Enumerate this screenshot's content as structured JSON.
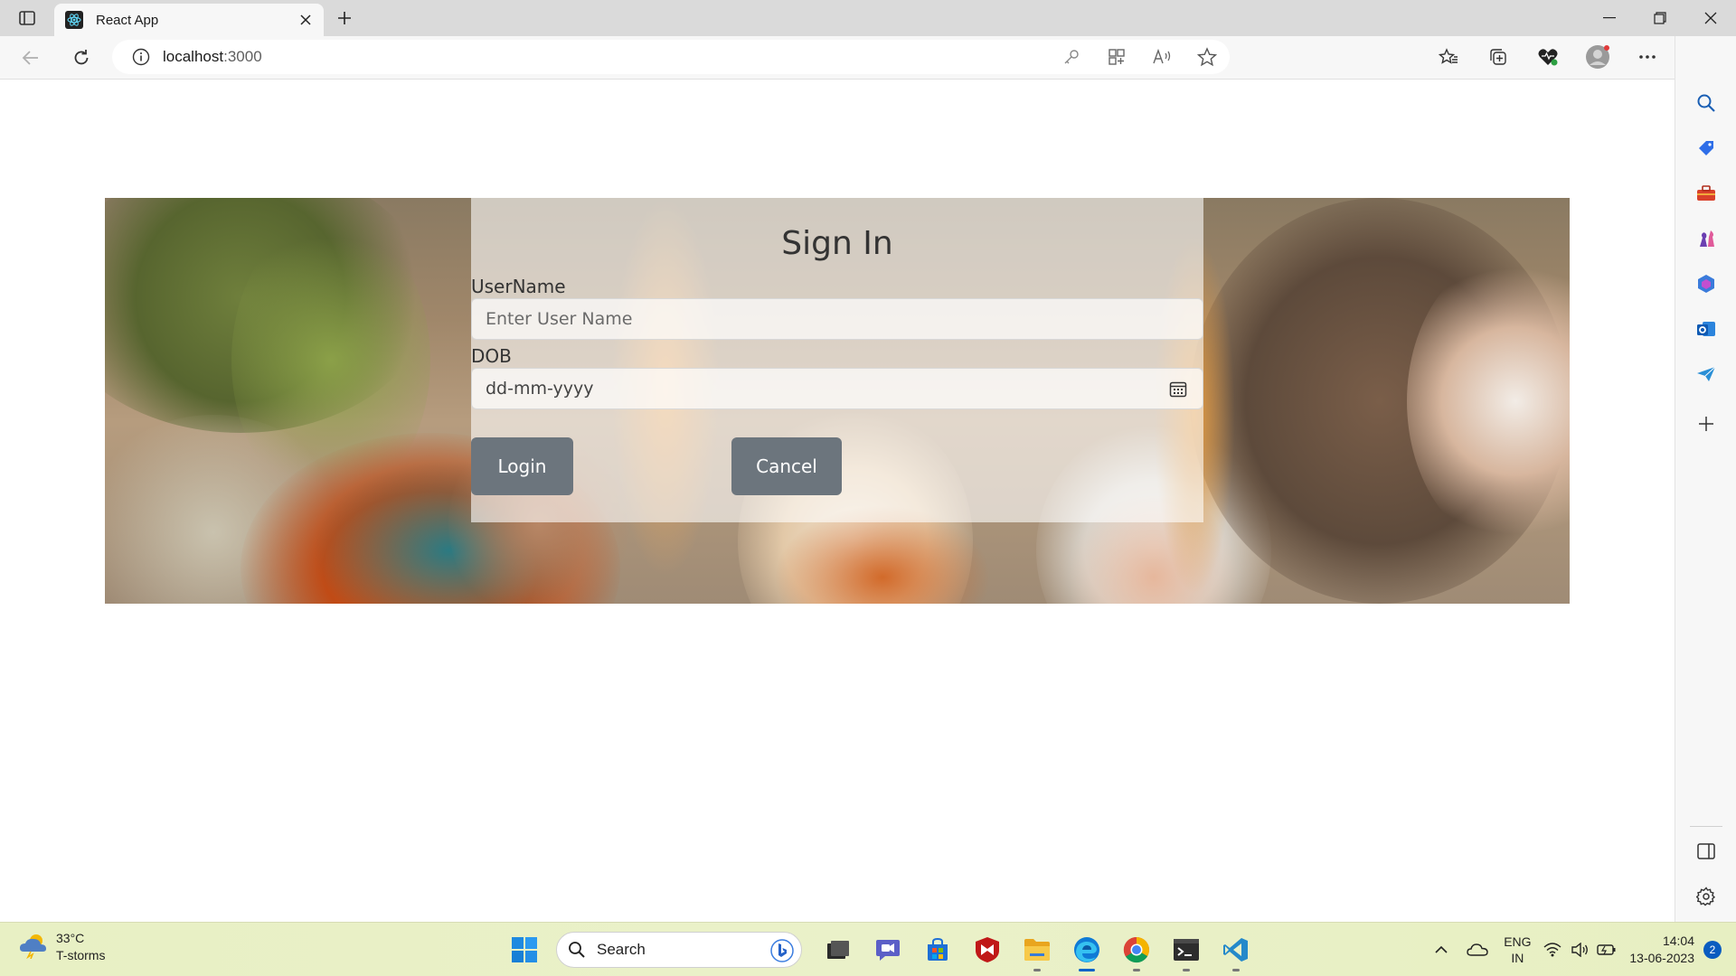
{
  "browser": {
    "tab_title": "React App",
    "url_host": "localhost",
    "url_port": ":3000"
  },
  "page": {
    "form": {
      "title": "Sign In",
      "username_label": "UserName",
      "username_placeholder": "Enter User Name",
      "dob_label": "DOB",
      "dob_placeholder": "dd-mm-yyyy",
      "login_label": "Login",
      "cancel_label": "Cancel"
    }
  },
  "taskbar": {
    "weather_temp": "33°C",
    "weather_desc": "T-storms",
    "search_label": "Search",
    "lang_line1": "ENG",
    "lang_line2": "IN",
    "time": "14:04",
    "date": "13-06-2023",
    "notification_count": "2"
  },
  "colors": {
    "button_bg": "#6c757d",
    "taskbar_bg": "#e9f0c8",
    "edge_accent": "#0a64c8"
  }
}
